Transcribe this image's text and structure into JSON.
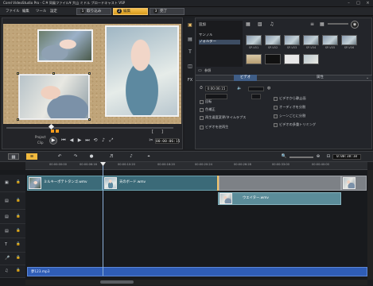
{
  "window": {
    "title": "Corel VideoStudio Pro - C:¥ 同風ファイル¥ 大山 ミドル ブロードキャスト VSP"
  },
  "menu": [
    "ファイル",
    "編集",
    "ツール",
    "設定"
  ],
  "steps": [
    {
      "num": "1",
      "label": "取り込み"
    },
    {
      "num": "2",
      "label": "編集"
    },
    {
      "num": "3",
      "label": "完了"
    }
  ],
  "player": {
    "project_label": "Project",
    "clip_label": "Clip",
    "timecode": "00:00:06:15",
    "bracket_in": "[",
    "bracket_out": "]"
  },
  "library": {
    "add_label": "追加",
    "tree": [
      "サンプル",
      "フォルダー"
    ],
    "thumbs": [
      "SP-V01",
      "SP-V02",
      "SP-V03",
      "SP-V04",
      "SP-V05",
      "SP-V06"
    ],
    "browse_label": "参照",
    "tabs": [
      "ビデオ",
      "属性"
    ],
    "options": [
      "回転",
      "色補正",
      "再生速度変更/タイムラプス",
      "ビデオを逆再生",
      "ビデオから静止画",
      "オーディオを分割",
      "シーンごとに分割",
      "ビデオの多重トリミング"
    ],
    "duration": "0:00:06:15"
  },
  "timeline": {
    "total_time": "0:00:38:10",
    "ruler": [
      "00:00:00:00",
      "00:00:06:16",
      "00:00:10:20",
      "00:00:16:20",
      "00:00:20:24",
      "00:00:26:28",
      "00:00:33:00",
      "00:00:40:00"
    ],
    "clips": {
      "video1": "ミルキーポテトタンゴ.wmv",
      "video2": "天のボード.wmv",
      "overlay": "ウエイター.wmv",
      "audio": "夢123.mp3"
    }
  },
  "colors": {
    "accent": "#f3c46b",
    "selected_tab": "#3f5d86",
    "audio_clip": "#2f5db6",
    "video_clip": "#3c6b79"
  }
}
